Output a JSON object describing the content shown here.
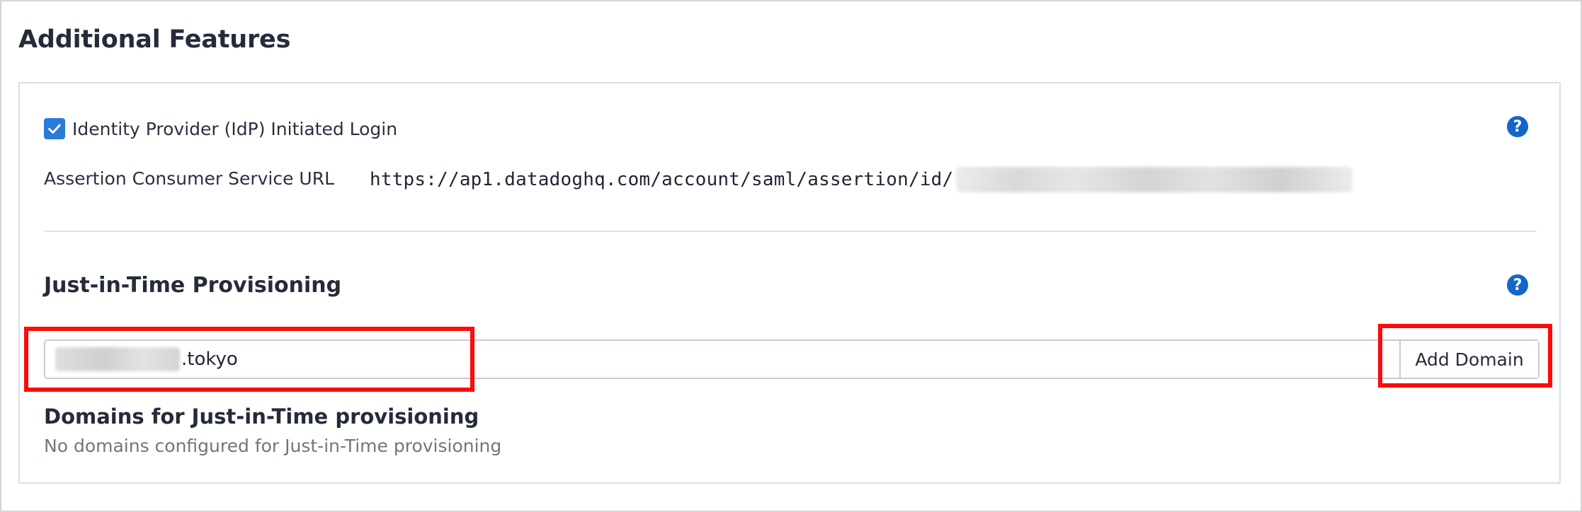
{
  "section": {
    "title": "Additional Features"
  },
  "idp": {
    "checkbox_checked": true,
    "label": "Identity Provider (IdP) Initiated Login",
    "help_icon": "question-circle-icon"
  },
  "acs": {
    "label": "Assertion Consumer Service URL",
    "url_prefix": "https://ap1.datadoghq.com/account/saml/assertion/id/"
  },
  "jit": {
    "title": "Just-in-Time Provisioning",
    "help_icon": "question-circle-icon",
    "input_value_suffix": ".tokyo",
    "add_button_label": "Add Domain",
    "domains_title": "Domains for Just-in-Time provisioning",
    "domains_empty": "No domains configured for Just-in-Time provisioning"
  },
  "colors": {
    "accent": "#2a7bd9",
    "help": "#1267c8",
    "highlight": "#ff0a0a"
  }
}
